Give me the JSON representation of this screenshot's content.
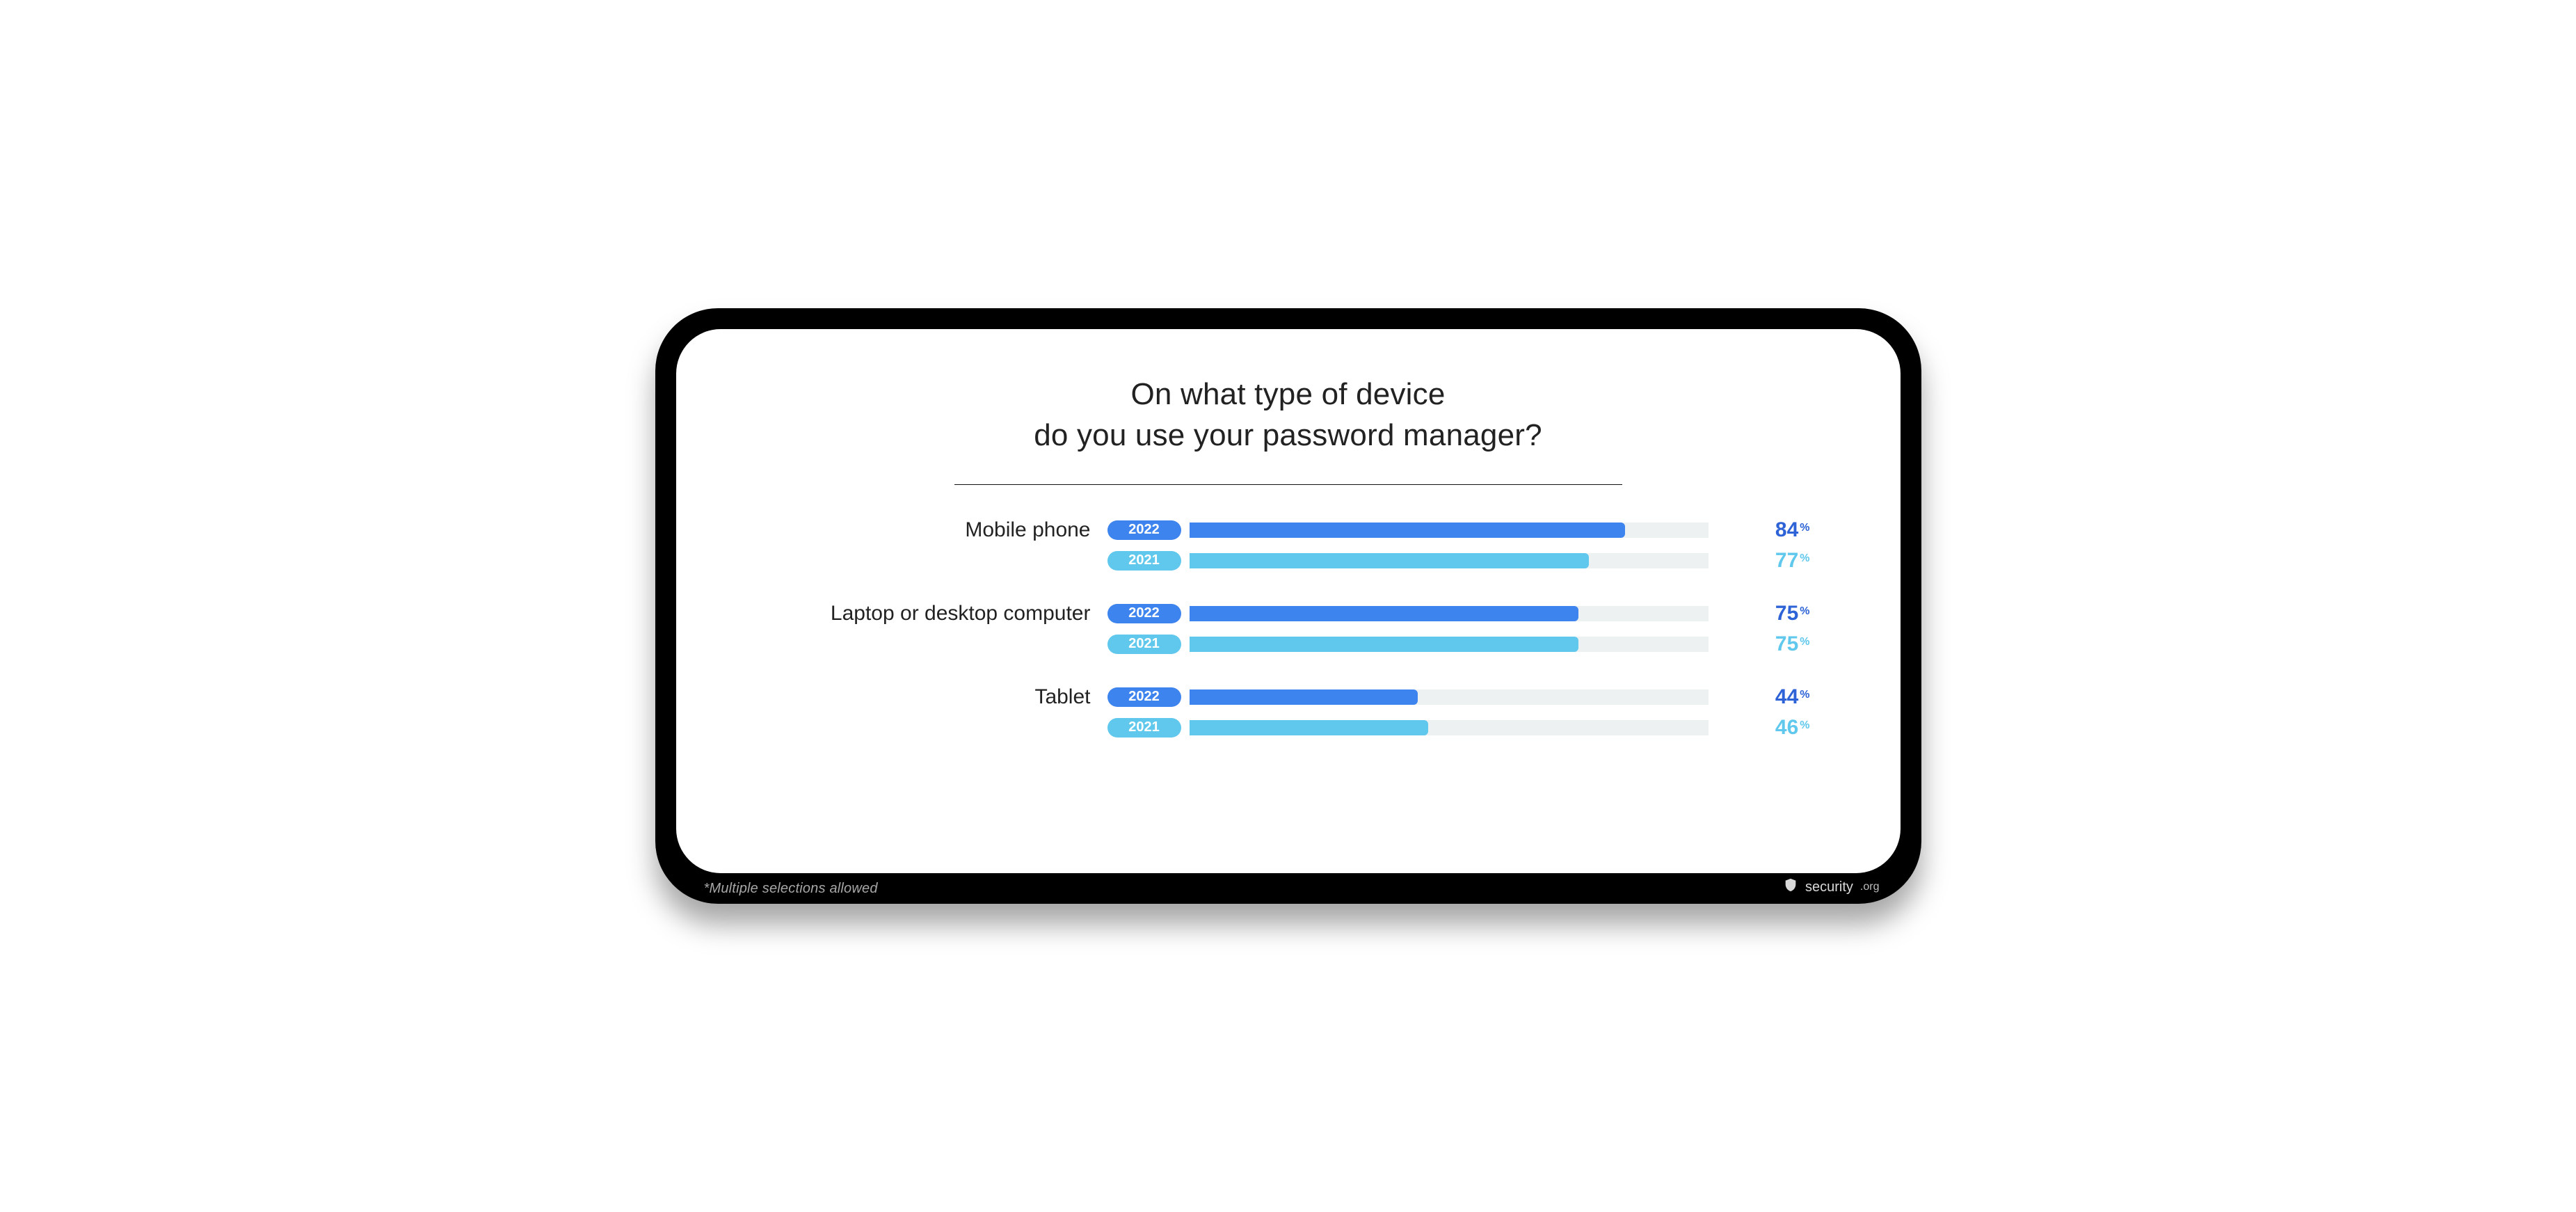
{
  "chart_data": {
    "type": "bar",
    "title": "On what type of device\ndo you use your password manager?",
    "xlabel": "",
    "ylabel": "",
    "xlim": [
      0,
      100
    ],
    "unit": "%",
    "categories": [
      "Mobile phone",
      "Laptop or desktop computer",
      "Tablet"
    ],
    "series": [
      {
        "name": "2022",
        "values": [
          84,
          75,
          44
        ],
        "color": "#3e84ee"
      },
      {
        "name": "2021",
        "values": [
          77,
          75,
          46
        ],
        "color": "#5fc8ec"
      }
    ],
    "footnote": "*Multiple selections allowed",
    "source": {
      "name": "security",
      "suffix": ".org"
    }
  }
}
